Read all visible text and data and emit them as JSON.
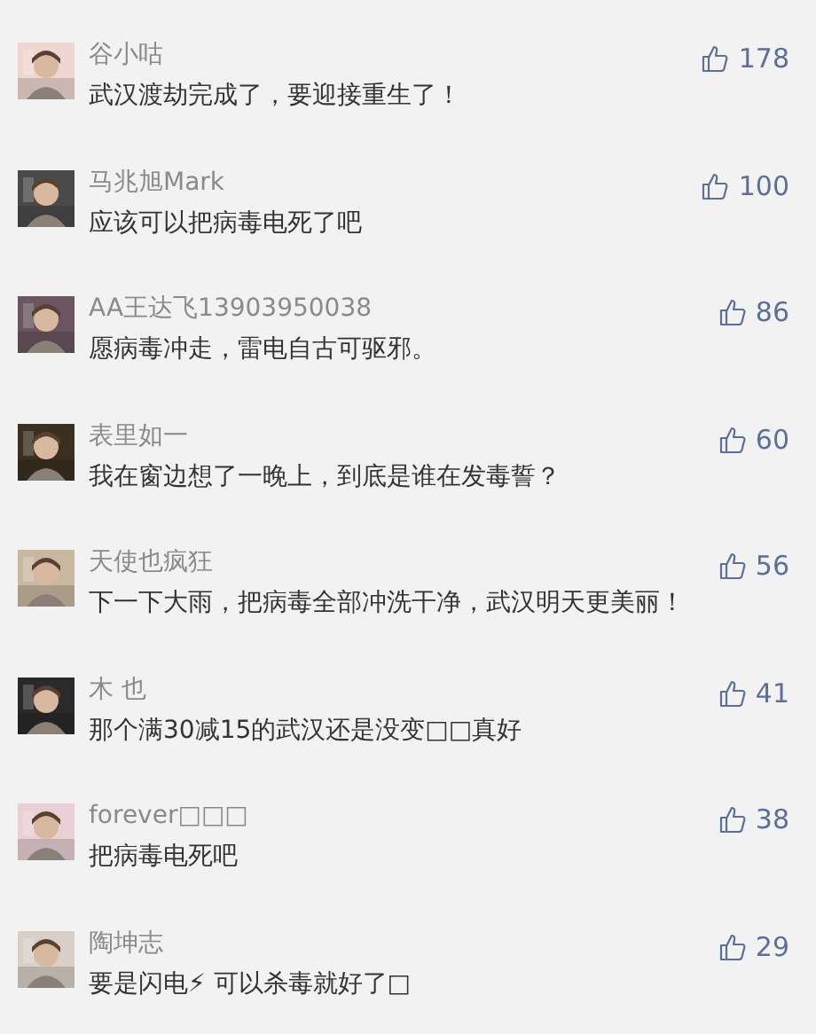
{
  "comments": [
    {
      "name": "谷小咕",
      "text": "武汉渡劫完成了，要迎接重生了！",
      "likes": "178"
    },
    {
      "name": "马兆旭Mark",
      "text": "应该可以把病毒电死了吧",
      "likes": "100"
    },
    {
      "name": "AA王达飞13903950038",
      "text": "愿病毒冲走，雷电自古可驱邪。",
      "likes": "86"
    },
    {
      "name": "表里如一",
      "text": "我在窗边想了一晚上，到底是谁在发毒誓？",
      "likes": "60"
    },
    {
      "name": "天使也疯狂",
      "text": "下一下大雨，把病毒全部冲洗干净，武汉明天更美丽！",
      "likes": "56"
    },
    {
      "name": "木 也",
      "text": "那个满30减15的武汉还是没变□□真好",
      "likes": "41"
    },
    {
      "name": "forever□□□",
      "text": "把病毒电死吧",
      "likes": "38"
    },
    {
      "name": "陶坤志",
      "text": "要是闪电⚡ 可以杀毒就好了□",
      "likes": "29"
    }
  ]
}
